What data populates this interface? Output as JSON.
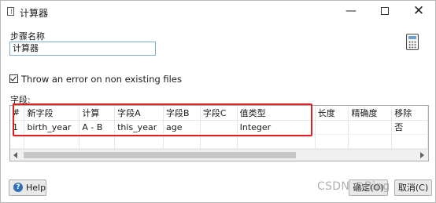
{
  "window": {
    "title": "计算器",
    "controls": {
      "minimize": "—",
      "close": "✕"
    }
  },
  "step": {
    "label": "步骤名称",
    "value": "计算器"
  },
  "options": {
    "throw_error_label": "Throw an error on non existing files",
    "throw_error_checked": true
  },
  "fields": {
    "label": "字段:",
    "columns": [
      "#",
      "新字段",
      "计算",
      "字段A",
      "字段B",
      "字段C",
      "值类型",
      "长度",
      "精确度",
      "移除"
    ],
    "rows": [
      [
        "1",
        "birth_year",
        "A - B",
        "this_year",
        "age",
        "",
        "Integer",
        "",
        "",
        "否"
      ]
    ]
  },
  "buttons": {
    "help": "Help",
    "ok": "确定(O)",
    "cancel": "取消(C)"
  },
  "watermark": "CSDN @Bing"
}
